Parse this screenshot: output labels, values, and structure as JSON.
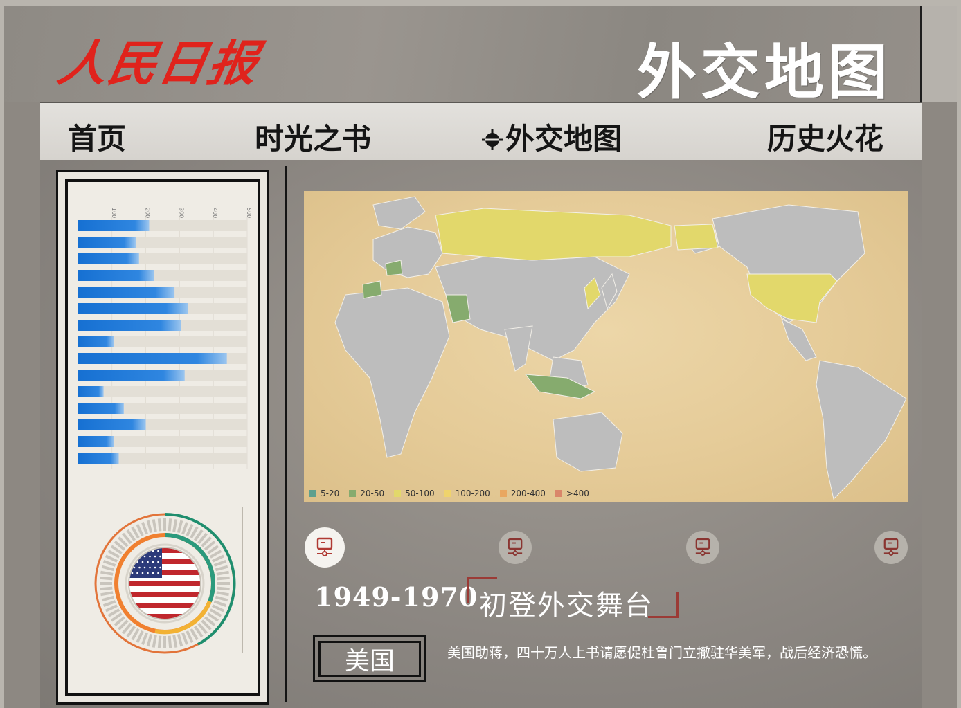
{
  "header": {
    "logo_text": "人民日报",
    "site_title": "外交地图"
  },
  "nav": {
    "items": [
      {
        "label": "首页"
      },
      {
        "label": "时光之书"
      },
      {
        "label": "外交地图"
      },
      {
        "label": "历史火花"
      }
    ],
    "active_index": 2
  },
  "chart_data": [
    {
      "type": "bar",
      "orientation": "horizontal",
      "tick_labels": [
        "100",
        "200",
        "300",
        "400",
        "500"
      ],
      "xlim": [
        0,
        500
      ],
      "values": [
        210,
        170,
        180,
        225,
        285,
        325,
        305,
        105,
        440,
        315,
        75,
        135,
        200,
        105,
        120
      ],
      "colors": {
        "bar": "#1a73d4",
        "track": "#e3dfd6"
      }
    }
  ],
  "map": {
    "legend": [
      {
        "label": "5-20",
        "color": "#5fa08e"
      },
      {
        "label": "20-50",
        "color": "#86ab6e"
      },
      {
        "label": "50-100",
        "color": "#e2d86b"
      },
      {
        "label": "100-200",
        "color": "#efd36c"
      },
      {
        "label": "200-400",
        "color": "#e9a760"
      },
      {
        "label": ">400",
        "color": "#d9866a"
      }
    ]
  },
  "timeline": {
    "nodes": 4,
    "active_index": 0
  },
  "era": {
    "year_range": "1949-1970",
    "title": "初登外交舞台"
  },
  "detail": {
    "country": "美国",
    "description": "美国助蒋，四十万人上书请愿促杜鲁门立撤驻华美军，战后经济恐慌。"
  },
  "icons": {
    "timeline_node": "presentation-icon",
    "flag": "us-flag-icon"
  }
}
